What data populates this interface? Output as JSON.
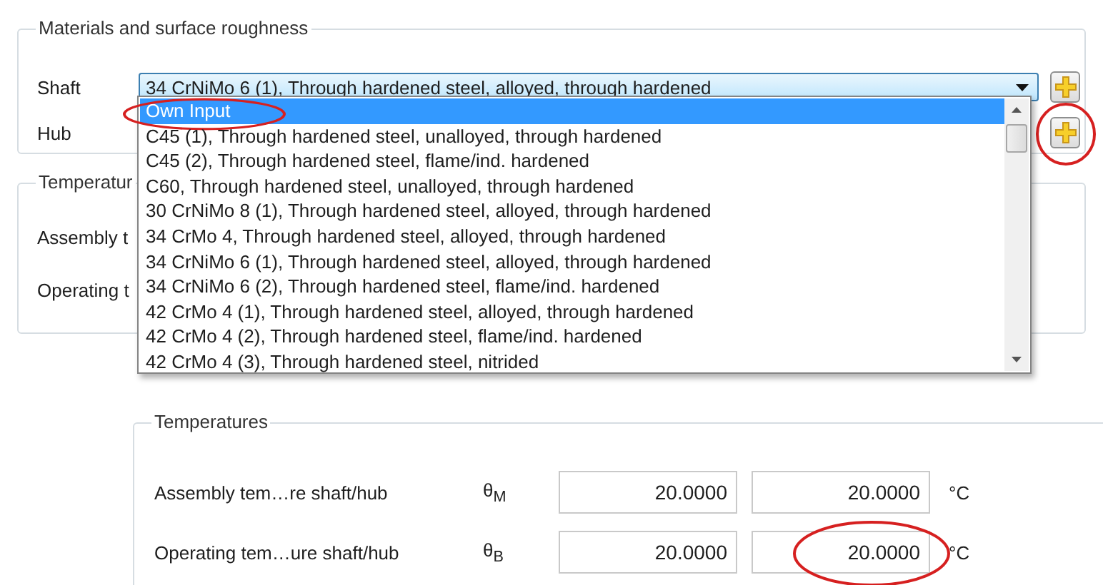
{
  "materials_group": {
    "title": "Materials and surface roughness",
    "rows": [
      {
        "label": "Shaft",
        "value": "34 CrNiMo 6  (1), Through hardened steel, alloyed, through hardened",
        "add_button_circled": false
      },
      {
        "label": "Hub",
        "add_button_circled": true
      }
    ]
  },
  "dropdown_list": {
    "items": [
      {
        "label": "Own Input",
        "selected": true,
        "circled": true
      },
      {
        "label": "C45 (1), Through hardened steel, unalloyed, through hardened",
        "selected": false,
        "circled": false
      },
      {
        "label": "C45 (2), Through hardened steel, flame/ind. hardened",
        "selected": false,
        "circled": false
      },
      {
        "label": "C60, Through hardened steel, unalloyed, through hardened",
        "selected": false,
        "circled": false
      },
      {
        "label": "30 CrNiMo 8 (1), Through hardened steel, alloyed, through hardened",
        "selected": false,
        "circled": false
      },
      {
        "label": "34 CrMo 4, Through hardened steel, alloyed, through hardened",
        "selected": false,
        "circled": false
      },
      {
        "label": "34 CrNiMo 6  (1), Through hardened steel, alloyed, through hardened",
        "selected": false,
        "circled": false
      },
      {
        "label": "34 CrNiMo 6  (2), Through hardened steel, flame/ind. hardened",
        "selected": false,
        "circled": false
      },
      {
        "label": "42 CrMo 4  (1), Through hardened steel, alloyed, through hardened",
        "selected": false,
        "circled": false
      },
      {
        "label": "42 CrMo 4  (2), Through hardened steel, flame/ind. hardened",
        "selected": false,
        "circled": false
      },
      {
        "label": "42 CrMo 4  (3), Through hardened steel, nitrided",
        "selected": false,
        "circled": false
      }
    ]
  },
  "covered_group": {
    "title": "Temperatur",
    "rows": [
      "Assembly t",
      "Operating t"
    ]
  },
  "temperatures_group": {
    "title": "Temperatures",
    "rows": [
      {
        "label": "Assembly tem…re shaft/hub",
        "symbol": "θ$_{M}$",
        "shaft_value": "20.0000",
        "hub_value": "20.0000",
        "unit": "°C",
        "hub_circled": false
      },
      {
        "label": "Operating tem…ure shaft/hub",
        "symbol": "θ$_{B}$",
        "shaft_value": "20.0000",
        "hub_value": "20.0000",
        "unit": "°C",
        "hub_circled": true
      }
    ]
  }
}
